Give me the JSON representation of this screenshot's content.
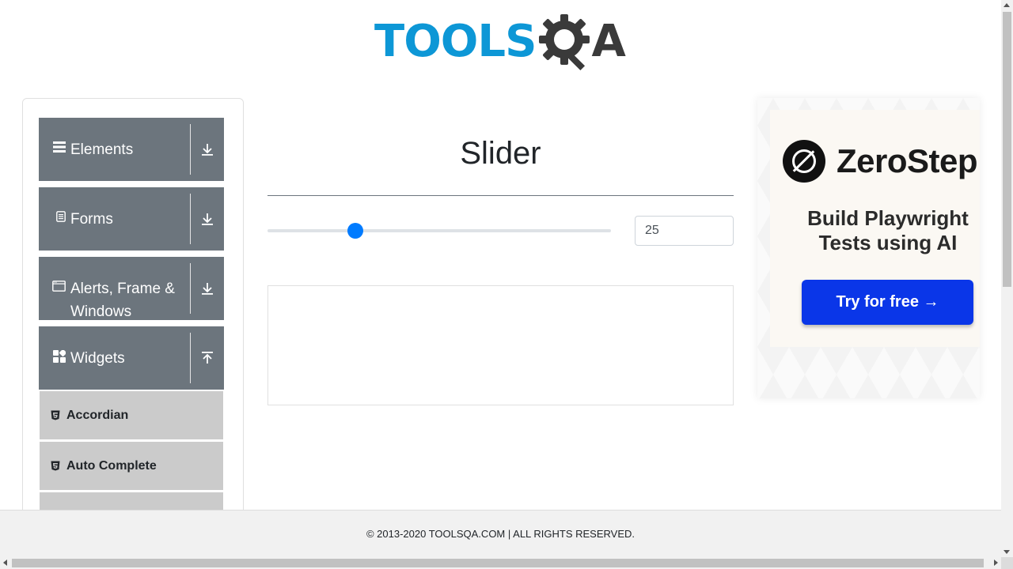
{
  "header": {
    "logo_tools": "TOOLS",
    "logo_q": "Q",
    "logo_a": "A",
    "logo_colors": {
      "tools": "#0d97d6",
      "qa": "#3a3a3a"
    }
  },
  "sidebar": {
    "groups": [
      {
        "label": "Elements",
        "icon": "hamburger-icon",
        "toggle_icon": "download-arrow-icon",
        "expanded": false
      },
      {
        "label": "Forms",
        "icon": "document-icon",
        "toggle_icon": "download-arrow-icon",
        "expanded": false
      },
      {
        "label": "Alerts, Frame & Windows",
        "icon": "window-icon",
        "toggle_icon": "download-arrow-icon",
        "expanded": false
      },
      {
        "label": "Widgets",
        "icon": "widgets-icon",
        "toggle_icon": "upload-arrow-icon",
        "expanded": true
      }
    ],
    "items": [
      {
        "label": "Accordian",
        "icon": "html5-icon"
      },
      {
        "label": "Auto Complete",
        "icon": "html5-icon"
      }
    ]
  },
  "main": {
    "title": "Slider",
    "slider": {
      "value": 25,
      "min": 0,
      "max": 100,
      "accent": "#007bff"
    },
    "slider_value_text": "25"
  },
  "ad": {
    "brand": "ZeroStep",
    "tagline": "Build Playwright Tests using AI",
    "cta": "Try for free →",
    "cta_color": "#0a36e8"
  },
  "footer": {
    "text": "© 2013-2020 TOOLSQA.COM | ALL RIGHTS RESERVED."
  }
}
